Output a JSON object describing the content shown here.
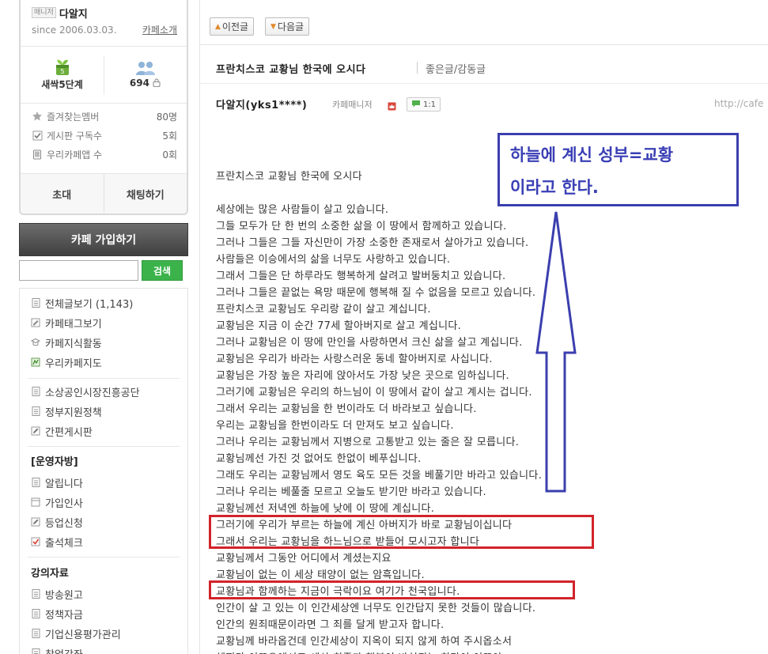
{
  "sidebar": {
    "manager_badge": "매니저",
    "manager_name": "다알지",
    "since": "since 2006.03.03.",
    "cafe_intro": "카페소개",
    "level_label": "새싹5단계",
    "member_count": "694",
    "stats": [
      {
        "label": "즐겨찾는멤버",
        "value": "80명",
        "icon": "star-icon"
      },
      {
        "label": "게시판 구독수",
        "value": "5회",
        "icon": "checkbox-icon"
      },
      {
        "label": "우리카페앱 수",
        "value": "0회",
        "icon": "phone-icon"
      }
    ],
    "invite_label": "초대",
    "chat_label": "채팅하기",
    "join_label": "카페 가입하기",
    "search_button": "검색",
    "menu_group1": [
      {
        "label": "전체글보기 (1,143)",
        "icon": "doc-icon"
      },
      {
        "label": "카페태그보기",
        "icon": "tag-icon"
      },
      {
        "label": "카페지식활동",
        "icon": "knowledge-icon"
      },
      {
        "label": "우리카페지도",
        "icon": "map-icon"
      }
    ],
    "menu_group2": [
      {
        "label": "소상공인시장진흥공단",
        "icon": "doc-icon"
      },
      {
        "label": "정부지원정책",
        "icon": "doc-icon"
      },
      {
        "label": "간편게시판",
        "icon": "edit-icon"
      }
    ],
    "section_ops": "[운영자방]",
    "menu_group3": [
      {
        "label": "알립니다",
        "icon": "doc-icon"
      },
      {
        "label": "가입인사",
        "icon": "board-icon"
      },
      {
        "label": "등업신청",
        "icon": "edit-icon"
      },
      {
        "label": "출석체크",
        "icon": "check-icon"
      }
    ],
    "section_lecture": "강의자료",
    "menu_group4": [
      {
        "label": "방송원고",
        "icon": "doc-icon"
      },
      {
        "label": "정책자금",
        "icon": "doc-icon"
      },
      {
        "label": "기업신용평가관리",
        "icon": "doc-icon"
      },
      {
        "label": "창업강좌",
        "icon": "doc-icon"
      }
    ]
  },
  "post": {
    "prev_label": "이전글",
    "next_label": "다음글",
    "title": "프란치스코 교황님 한국에 오시다",
    "category": "좋은글/감동글",
    "author": "다알지(yks1****)",
    "author_role": "카페매니저",
    "chat_count": "1:1",
    "url": "http://cafe",
    "body_title": "프란치스코 교황님 한국에 오시다",
    "lines": [
      "세상에는 많은 사람들이 살고 있습니다.",
      "그들 모두가 단 한 번의 소중한 삶을 이 땅에서 함께하고 있습니다.",
      "그러나 그들은 그들 자신만이 가장 소중한 존재로서 살아가고 있습니다.",
      "사람들은 이승에서의 삶을 너무도 사랑하고 있습니다.",
      "그래서 그들은 단 하루라도 행복하게 살려고 발버둥치고 있습니다.",
      "그러나 그들은 끝없는 욕망 때문에 행복해 질 수 없음을 모르고 있습니다.",
      "프란치스코 교황님도 우리랑 같이 살고 계십니다.",
      "교황님은 지금 이 순간 77세 할아버지로 살고 계십니다.",
      "그러나 교황님은 이 땅에 만인을 사랑하면서 크신 삶을 살고 계십니다.",
      "교황님은 우리가 바라는 사랑스러운 동네 할아버지로 사십니다.",
      "교황님은 가장 높은 자리에 앉아서도 가장 낮은 곳으로 임하십니다.",
      "그러기에 교황님은 우리의 하느님이 이 땅에서 같이 살고 계시는 겁니다.",
      "그래서 우리는 교황님을 한 번이라도 더 바라보고 싶습니다.",
      "우리는 교황님을 한번이라도 더 만져도 보고 싶습니다.",
      "그러나 우리는 교황님께서 지병으로 고통받고 있는 줄은 잘 모릅니다.",
      "교황님께선 가진 것 없어도 한없이 베푸십니다.",
      "그래도 우리는 교황님께서 영도 육도 모든 것을 베풀기만 바라고 있습니다.",
      "그러나 우리는 베풀줄 모르고 오늘도 받기만 바라고 있습니다.",
      "교황님께선 저녁엔 하늘에 낮에 이 땅에 계십니다.",
      "그러기에 우리가 부르는 하늘에 계신 아버지가 바로 교황님이십니다",
      "그래서 우리는 교황님을 하느님으로 받들어 모시고자 합니다",
      "교황님께서 그동안 어디에서 계셨는지요",
      "교황님이 없는 이 세상 태양이 없는 암흑입니다.",
      "교황님과 함께하는 지금이 극락이요 여기가 천국입니다.",
      "인간이 살 고 있는 이 인간세상엔 너무도 인간답지 못한 것들이 많습니다.",
      "인간의 원죄때문이라면 그 죄를 달게 받고자 합니다.",
      "교황님께 바라옵건데 인간세상이 지옥이 되지 않게 하여 주시옵소서",
      "헤피가 이뜨으에서도 세상 최종과 행복이 바쳐되는 희망이 이뜨아"
    ]
  },
  "annotation": {
    "line1": "하늘에 계신 성부=교황",
    "line2": "이라고 한다.",
    "box_color": "#3b3fae",
    "highlight_color": "#d2232a"
  }
}
